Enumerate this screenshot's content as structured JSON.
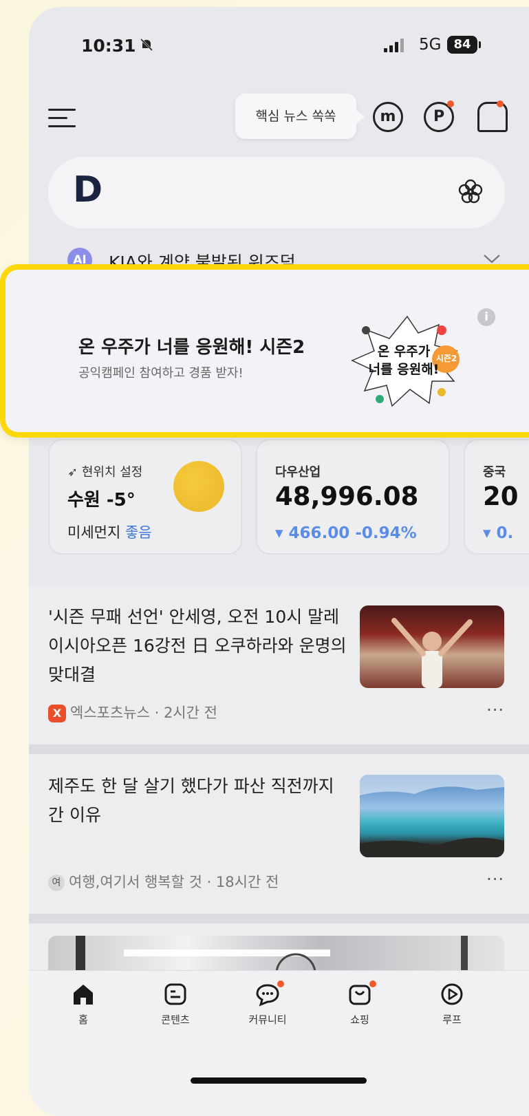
{
  "status": {
    "time": "10:31",
    "network": "5G",
    "battery": "84"
  },
  "header": {
    "tooltip": "핵심 뉴스 쏙쏙",
    "m_icon_label": "m",
    "p_icon_label": "P"
  },
  "search": {
    "logo": "D"
  },
  "ai_summary": {
    "badge": "AI",
    "text": "KIA와 계약 불발된 위즈덤"
  },
  "ad_banner": {
    "title": "온 우주가 너를 응원해! 시즌2",
    "subtitle": "공익캠페인 참여하고 경품 받자!",
    "art_text_line1": "온 우주가",
    "art_text_line2": "너를 응원해!",
    "art_badge": "시즌2"
  },
  "widgets": {
    "weather": {
      "location_set": "현위치 설정",
      "city_temp": "수원 -5°",
      "dust_label": "미세먼지",
      "dust_value": "좋음"
    },
    "dow": {
      "name": "다우산업",
      "value": "48,996.08",
      "change": "▾ 466.00  -0.94%"
    },
    "china": {
      "name": "중국",
      "value": "20",
      "change": "▾ 0."
    }
  },
  "news": [
    {
      "headline": "'시즌 무패 선언' 안세영,  오전 10시 말레이시아오픈 16강전 日 오쿠하라와 운명의 맞대결",
      "source_icon": "X",
      "source": "엑스포츠뉴스 · 2시간 전"
    },
    {
      "headline": "제주도 한 달 살기 했다가 파산 직전까지 간 이유",
      "source_icon": "여",
      "source": "여행,여기서 행복할 것 · 18시간 전"
    }
  ],
  "more_label": "···",
  "nav": [
    {
      "label": "홈",
      "icon": "home-icon"
    },
    {
      "label": "콘텐츠",
      "icon": "contents-icon"
    },
    {
      "label": "커뮤니티",
      "icon": "chat-icon"
    },
    {
      "label": "쇼핑",
      "icon": "shopping-bag-icon"
    },
    {
      "label": "루프",
      "icon": "play-icon"
    }
  ],
  "colors": {
    "banner_border": "#fcd80a",
    "accent_blue": "#5b8de6",
    "notification_red": "#f25a2c",
    "ai_badge": "#8b8fe8"
  }
}
